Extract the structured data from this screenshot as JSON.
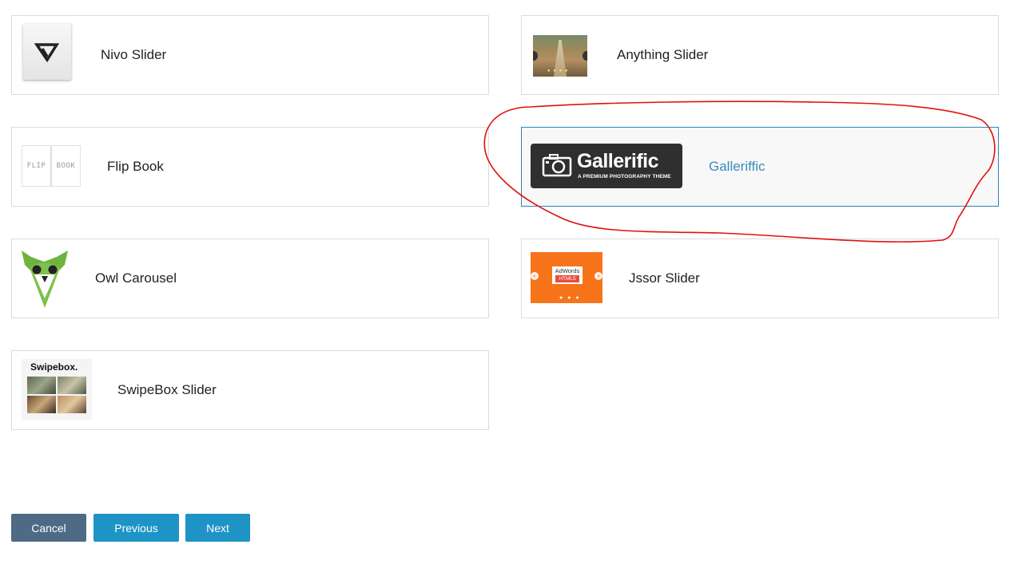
{
  "options": [
    {
      "label": "Nivo Slider"
    },
    {
      "label": "Anything Slider"
    },
    {
      "label": "Flip Book"
    },
    {
      "label": "Galleriffic"
    },
    {
      "label": "Owl Carousel"
    },
    {
      "label": "Jssor Slider"
    },
    {
      "label": "SwipeBox Slider"
    }
  ],
  "selected_option": "Galleriffic",
  "thumbnails": {
    "flip_left": "FLIP",
    "flip_right": "BOOK",
    "galleriffic_logo": "Gallerific",
    "galleriffic_tagline": "A PREMIUM PHOTOGRAPHY THEME",
    "jssor_ad": "AdWords",
    "jssor_html5": "HTML5",
    "swipebox_title": "Swipebox."
  },
  "buttons": {
    "cancel": "Cancel",
    "previous": "Previous",
    "next": "Next"
  },
  "colors": {
    "selected_border": "#2a86b5",
    "selected_label": "#3a8cb9",
    "primary_button": "#1e93c6",
    "cancel_button": "#4e6a85",
    "annotation": "#e01010"
  }
}
